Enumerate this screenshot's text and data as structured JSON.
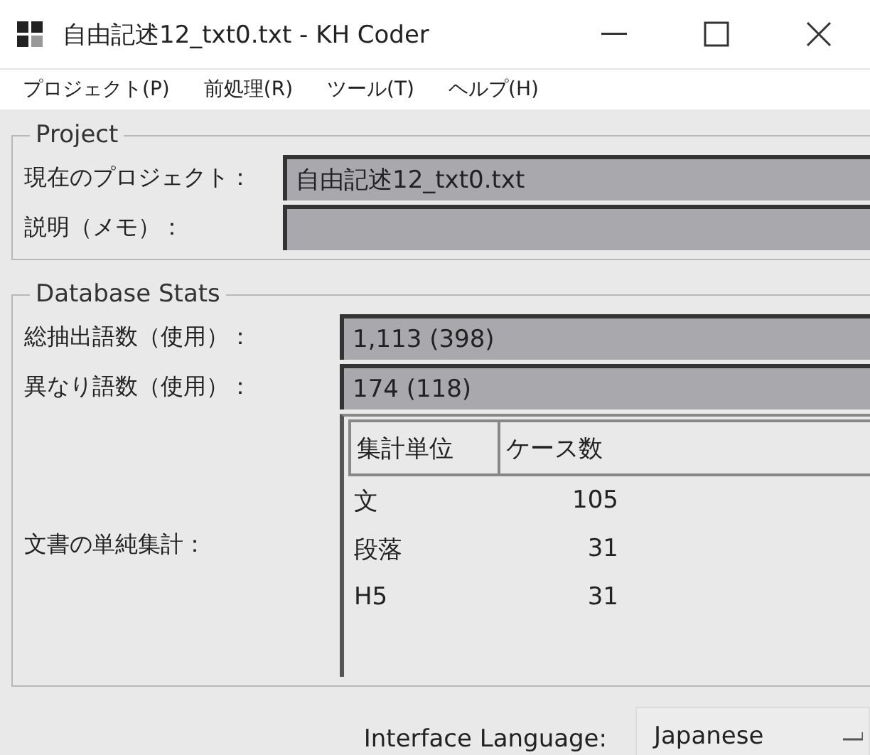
{
  "window": {
    "title": "自由記述12_txt0.txt - KH Coder"
  },
  "menu": [
    "プロジェクト(P)",
    "前処理(R)",
    "ツール(T)",
    "ヘルプ(H)"
  ],
  "project": {
    "title": "Project",
    "fields": [
      {
        "label": "現在のプロジェクト：",
        "value": "自由記述12_txt0.txt"
      },
      {
        "label": "説明（メモ）："
      }
    ]
  },
  "database_stats": {
    "title": "Database Stats",
    "fields": [
      {
        "label": "総抽出語数（使用）：",
        "value": "1,113 (398)"
      },
      {
        "label": "異なり語数（使用）：",
        "value": "174 (118)"
      }
    ],
    "table_label": "文書の単純集計：",
    "table": {
      "columns": [
        "集計単位",
        "ケース数"
      ],
      "rows": [
        [
          "文",
          "105"
        ],
        [
          "段落",
          "31"
        ],
        [
          "H5",
          "31"
        ]
      ]
    }
  },
  "interface_language": {
    "label": "Interface Language:",
    "value": "Japanese"
  }
}
